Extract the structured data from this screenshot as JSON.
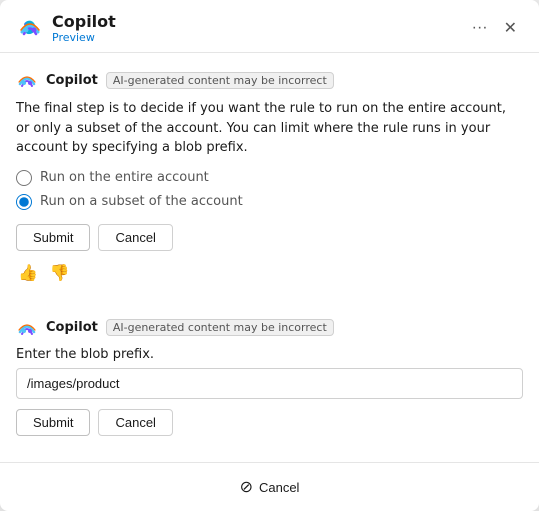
{
  "header": {
    "title": "Copilot",
    "subtitle": "Preview",
    "more_icon": "ellipsis",
    "close_icon": "close"
  },
  "messages": [
    {
      "id": "msg1",
      "sender": "Copilot",
      "badge": "AI-generated content may be incorrect",
      "text": "The final step is to decide if you want the rule to run on the entire account, or only a subset of the account. You can limit where the rule runs in your account by specifying a blob prefix.",
      "radio_options": [
        {
          "id": "opt1",
          "label": "Run on the entire account",
          "checked": false
        },
        {
          "id": "opt2",
          "label": "Run on a subset of the account",
          "checked": true
        }
      ],
      "submit_label": "Submit",
      "cancel_label": "Cancel",
      "feedback": {
        "thumbs_up": "👍",
        "thumbs_down": "👎"
      }
    },
    {
      "id": "msg2",
      "sender": "Copilot",
      "badge": "AI-generated content may be incorrect",
      "input_label": "Enter the blob prefix.",
      "input_placeholder": "",
      "input_value": "/images/product",
      "submit_label": "Submit",
      "cancel_label": "Cancel"
    }
  ],
  "bottom_bar": {
    "cancel_label": "Cancel",
    "cancel_icon": "cancel-circle"
  }
}
